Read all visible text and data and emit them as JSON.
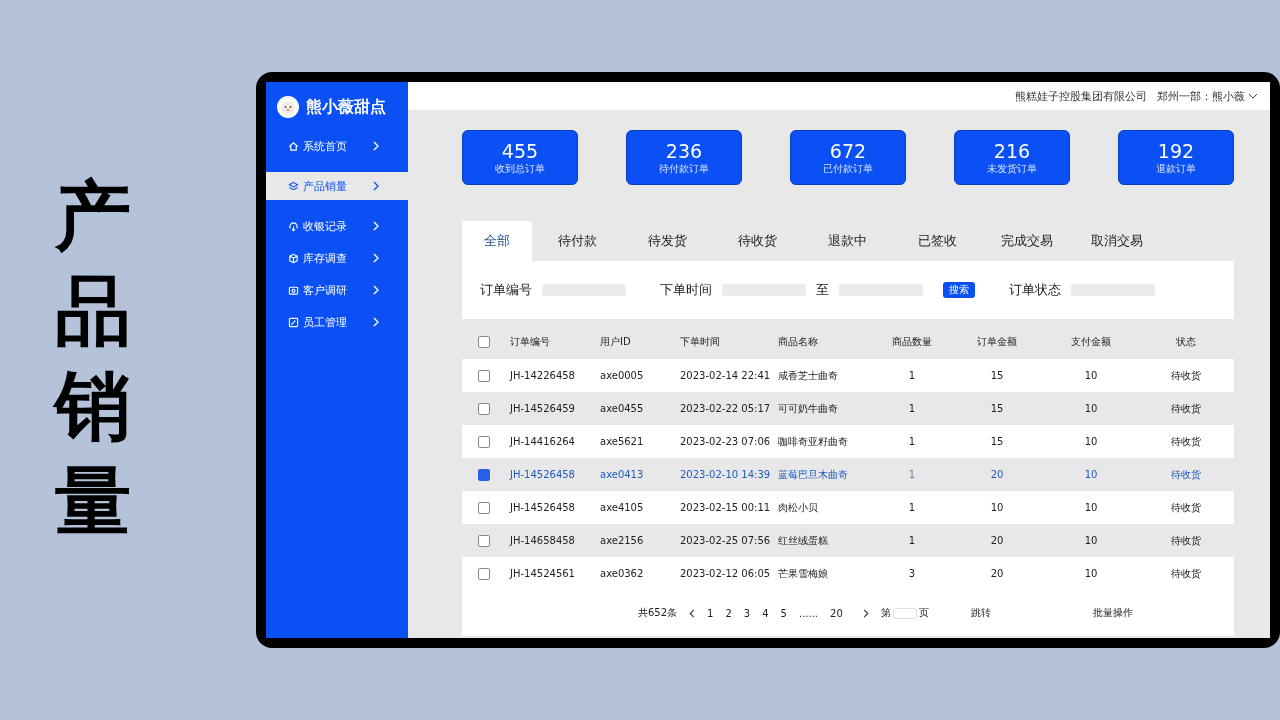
{
  "slide_title": "产品销量",
  "brand": {
    "name": "熊小薇甜点"
  },
  "sidebar": {
    "items": [
      {
        "label": "系统首页",
        "selected": false
      },
      {
        "label": "产品销量",
        "selected": true
      },
      {
        "label": "收银记录",
        "selected": false
      },
      {
        "label": "库存调查",
        "selected": false
      },
      {
        "label": "客户调研",
        "selected": false
      },
      {
        "label": "员工管理",
        "selected": false
      }
    ]
  },
  "header": {
    "company": "熊糕娃子控股集团有限公司",
    "user": "郑州一部：熊小薇"
  },
  "stats": [
    {
      "value": "455",
      "label": "收到总订单"
    },
    {
      "value": "236",
      "label": "待付款订单"
    },
    {
      "value": "672",
      "label": "已付款订单"
    },
    {
      "value": "216",
      "label": "未发货订单"
    },
    {
      "value": "192",
      "label": "退款订单"
    }
  ],
  "tabs": [
    {
      "label": "全部",
      "selected": true
    },
    {
      "label": "待付款",
      "selected": false
    },
    {
      "label": "待发货",
      "selected": false
    },
    {
      "label": "待收货",
      "selected": false
    },
    {
      "label": "退款中",
      "selected": false
    },
    {
      "label": "已签收",
      "selected": false
    },
    {
      "label": "完成交易",
      "selected": false
    },
    {
      "label": "取消交易",
      "selected": false
    }
  ],
  "filters": {
    "order_no_label": "订单编号",
    "time_label": "下单时间",
    "to_label": "至",
    "search_button": "搜索",
    "status_label": "订单状态"
  },
  "table": {
    "all_checked": false,
    "columns": [
      "订单编号",
      "用户ID",
      "下单时间",
      "商品名称",
      "商品数量",
      "订单金额",
      "支付金额",
      "状态"
    ],
    "rows": [
      {
        "selected": false,
        "cells": [
          "JH-14226458",
          "axe0005",
          "2023-02-14 22:41",
          "咸香芝士曲奇",
          "1",
          "15",
          "10",
          "待收货"
        ]
      },
      {
        "selected": false,
        "cells": [
          "JH-14526459",
          "axe0455",
          "2023-02-22 05:17",
          "可可奶牛曲奇",
          "1",
          "15",
          "10",
          "待收货"
        ]
      },
      {
        "selected": false,
        "cells": [
          "JH-14416264",
          "axe5621",
          "2023-02-23 07:06",
          "咖啡奇亚籽曲奇",
          "1",
          "15",
          "10",
          "待收货"
        ]
      },
      {
        "selected": true,
        "cells": [
          "JH-14526458",
          "axe0413",
          "2023-02-10 14:39",
          "蓝莓巴旦木曲奇",
          "1",
          "20",
          "10",
          "待收货"
        ]
      },
      {
        "selected": false,
        "cells": [
          "JH-14526458",
          "axe4105",
          "2023-02-15 00:11",
          "肉松小贝",
          "1",
          "10",
          "10",
          "待收货"
        ]
      },
      {
        "selected": false,
        "cells": [
          "JH-14658458",
          "axe2156",
          "2023-02-25 07:56",
          "红丝绒蛋糕",
          "1",
          "20",
          "10",
          "待收货"
        ]
      },
      {
        "selected": false,
        "cells": [
          "JH-14524561",
          "axe0362",
          "2023-02-12 06:05",
          "芒果雪梅娘",
          "3",
          "20",
          "10",
          "待收货"
        ]
      }
    ]
  },
  "pagination": {
    "total": "共652条",
    "pages": [
      "1",
      "2",
      "3",
      "4",
      "5"
    ],
    "ellipsis": "......",
    "last": "20",
    "goto_prefix": "第",
    "goto_suffix": "页",
    "jump": "跳转",
    "batch": "批量操作"
  }
}
